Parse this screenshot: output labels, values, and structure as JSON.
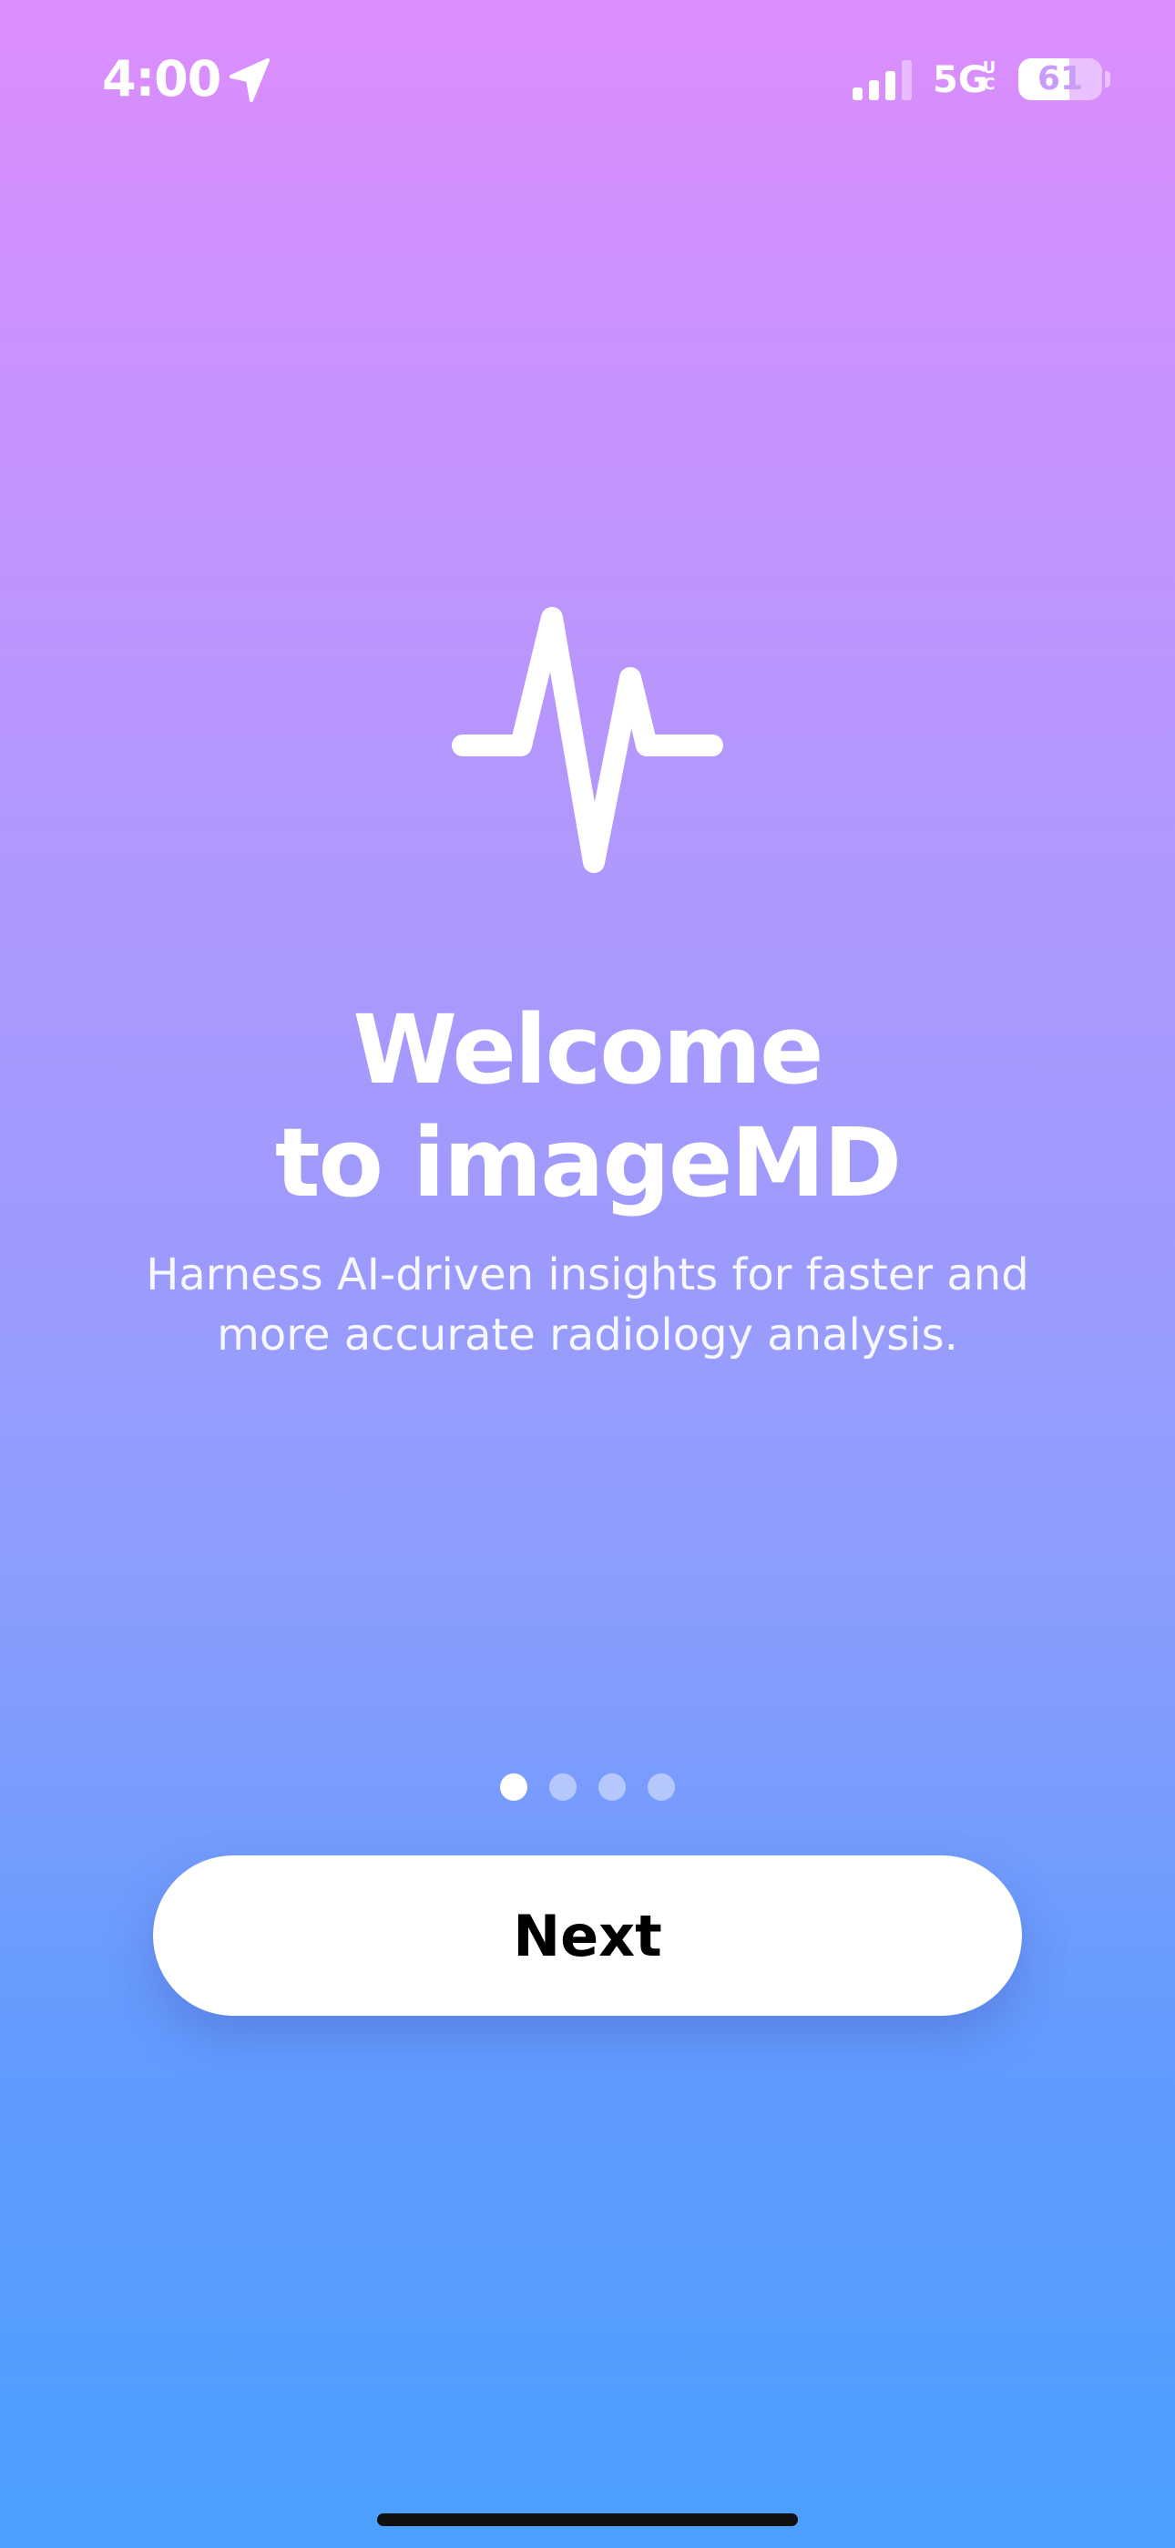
{
  "status_bar": {
    "time": "4:00",
    "network": "5G",
    "network_super_top": "U",
    "network_super_bottom": "C",
    "battery_level": "61",
    "battery_fraction": 0.61,
    "signal_bars_active": 3,
    "icons": [
      "location-arrow-icon",
      "cellular-signal-icon",
      "battery-icon"
    ]
  },
  "hero": {
    "icon": "heartbeat-pulse-icon",
    "title_line1": "Welcome",
    "title_line2": "to imageMD",
    "subtitle": "Harness AI-driven insights for faster and more accurate radiology analysis."
  },
  "pager": {
    "total": 4,
    "current": 1
  },
  "actions": {
    "next_label": "Next"
  },
  "colors": {
    "gradient_top": "#dc8dfd",
    "gradient_bottom": "#4c9ffe",
    "button_bg": "#ffffff",
    "button_text": "#000000"
  }
}
